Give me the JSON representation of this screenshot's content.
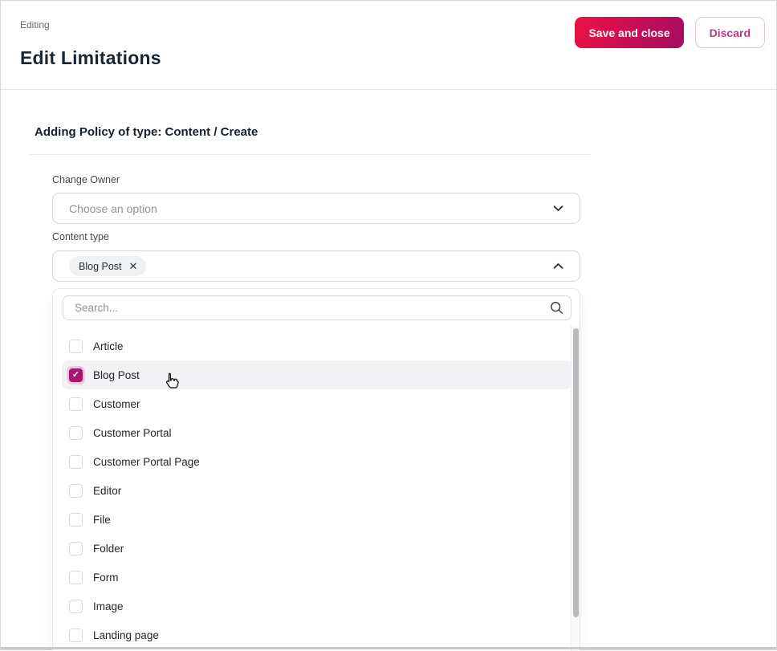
{
  "page": {
    "eyebrow": "Editing",
    "title": "Edit Limitations"
  },
  "header": {
    "save_label": "Save and close",
    "discard_label": "Discard"
  },
  "colors": {
    "accent_gradient_start": "#ec1243",
    "accent_gradient_end": "#a30c61",
    "discard_text": "#c73583",
    "discard_border": "#f3bed6",
    "checkbox_checked": "#a8176c",
    "checkbox_ring": "#f0c7e0",
    "row_highlight": "#f2f2f4",
    "title_text": "#192434"
  },
  "icons": {
    "close": "✕",
    "check": "✓",
    "chevron_down": "chevron-down",
    "chevron_up": "chevron-up",
    "search": "magnifier"
  },
  "form": {
    "section_heading": "Adding Policy of type: Content / Create",
    "change_owner": {
      "label": "Change Owner",
      "placeholder": "Choose an option"
    },
    "content_type": {
      "label": "Content type",
      "selected_chip": "Blog Post"
    },
    "dropdown": {
      "search_placeholder": "Search...",
      "options": [
        {
          "label": "Article",
          "checked": false,
          "highlighted": false
        },
        {
          "label": "Blog Post",
          "checked": true,
          "highlighted": true
        },
        {
          "label": "Customer",
          "checked": false,
          "highlighted": false
        },
        {
          "label": "Customer Portal",
          "checked": false,
          "highlighted": false
        },
        {
          "label": "Customer Portal Page",
          "checked": false,
          "highlighted": false
        },
        {
          "label": "Editor",
          "checked": false,
          "highlighted": false
        },
        {
          "label": "File",
          "checked": false,
          "highlighted": false
        },
        {
          "label": "Folder",
          "checked": false,
          "highlighted": false
        },
        {
          "label": "Form",
          "checked": false,
          "highlighted": false
        },
        {
          "label": "Image",
          "checked": false,
          "highlighted": false
        },
        {
          "label": "Landing page",
          "checked": false,
          "highlighted": false
        }
      ]
    }
  }
}
